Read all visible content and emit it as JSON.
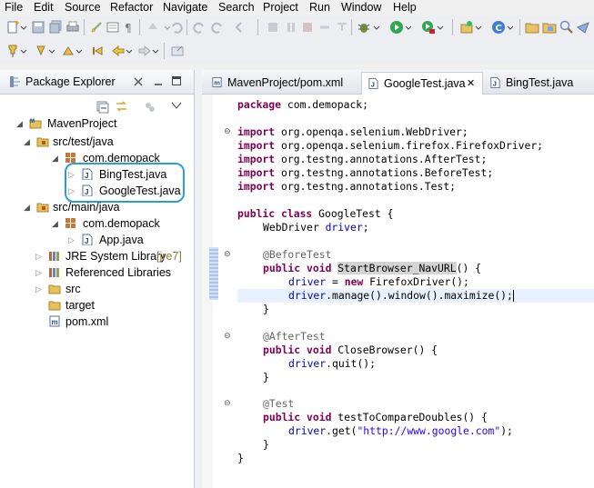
{
  "menu": [
    "File",
    "Edit",
    "Source",
    "Refactor",
    "Navigate",
    "Search",
    "Project",
    "Run",
    "Window",
    "Help"
  ],
  "explorer": {
    "title": "Package Explorer",
    "items": [
      {
        "label": "MavenProject"
      },
      {
        "label": "src/test/java"
      },
      {
        "label": "com.demopack"
      },
      {
        "label": "BingTest.java"
      },
      {
        "label": "GoogleTest.java"
      },
      {
        "label": "src/main/java"
      },
      {
        "label": "com.demopack"
      },
      {
        "label": "App.java"
      },
      {
        "label": "JRE System Library",
        "suffix": "[jre7]"
      },
      {
        "label": "Referenced Libraries"
      },
      {
        "label": "src"
      },
      {
        "label": "target"
      },
      {
        "label": "pom.xml"
      }
    ]
  },
  "tabs": [
    {
      "label": "MavenProject/pom.xml"
    },
    {
      "label": "GoogleTest.java",
      "close": "✕"
    },
    {
      "label": "BingTest.java"
    }
  ],
  "code": {
    "l1a": "package ",
    "l1b": "com.demopack;",
    "imp": "import ",
    "i1": "org.openqa.selenium.WebDriver;",
    "i2": "org.openqa.selenium.firefox.FirefoxDriver;",
    "i3": "org.testng.annotations.AfterTest;",
    "i4": "org.testng.annotations.BeforeTest;",
    "i5": "org.testng.annotations.Test;",
    "pc": "public class ",
    "cn": "GoogleTest {",
    "wd": "WebDriver ",
    "drv": "driver",
    "semi": ";",
    "bt": "@BeforeTest",
    "pv": "public void ",
    "m1": "StartBrowser_NavURL",
    "paren": "() {",
    "eq": " = ",
    "new": "new ",
    "ffd": "FirefoxDriver();",
    "max": ".manage().window().maximize();",
    "close": "}",
    "at": "@AfterTest",
    "m2": "CloseBrowser() {",
    "quit": ".quit();",
    "tt": "@Test",
    "m3": "testToCompareDoubles() {",
    "get1": ".get(",
    "url": "\"http://www.google.com\"",
    "get2": ");"
  }
}
